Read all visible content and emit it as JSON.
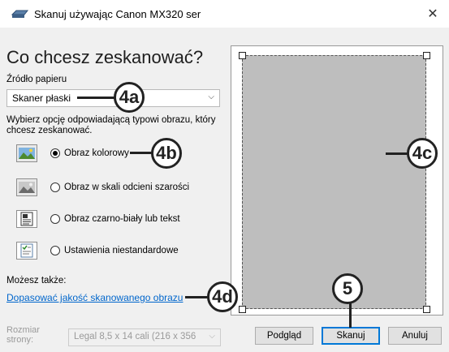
{
  "window": {
    "title": "Skanuj używając Canon MX320 ser",
    "close_glyph": "✕"
  },
  "main": {
    "heading": "Co chcesz zeskanować?",
    "paper_source_label": "Źródło papieru",
    "paper_source_value": "Skaner płaski",
    "picture_type_label": "Wybierz opcję odpowiadającą typowi obrazu, który chcesz zeskanować.",
    "options": [
      {
        "label": "Obraz kolorowy",
        "checked": true,
        "icon": "color-picture-icon"
      },
      {
        "label": "Obraz w skali odcieni szarości",
        "checked": false,
        "icon": "grayscale-picture-icon"
      },
      {
        "label": "Obraz czarno-biały lub tekst",
        "checked": false,
        "icon": "black-white-text-icon"
      },
      {
        "label": "Ustawienia niestandardowe",
        "checked": false,
        "icon": "custom-settings-icon"
      }
    ],
    "also_label": "Możesz także:",
    "adjust_link": "Dopasować jakość skanowanego obrazu",
    "page_size_label": "Rozmiar strony:",
    "page_size_value": "Legal 8,5 x 14 cali (216 x 356"
  },
  "buttons": {
    "preview": "Podgląd",
    "scan": "Skanuj",
    "cancel": "Anuluj"
  },
  "callouts": {
    "c4a": "4a",
    "c4b": "4b",
    "c4c": "4c",
    "c4d": "4d",
    "c5": "5"
  }
}
